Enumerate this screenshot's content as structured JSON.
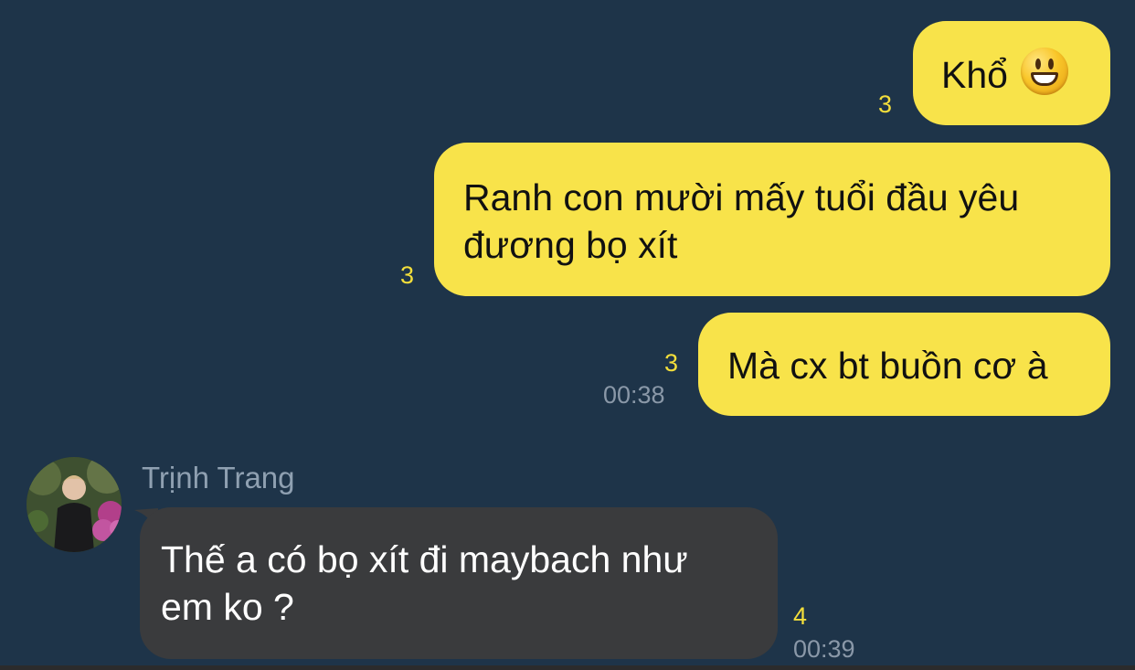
{
  "messages": [
    {
      "text": "Khổ",
      "emoji": "grinning-face-emoji",
      "read_count": "3"
    },
    {
      "line1": "Ranh con mười mấy tuổi đầu yêu",
      "line2": "đương bọ xít",
      "read_count": "3"
    },
    {
      "text": "Mà cx bt buồn cơ à",
      "read_count": "3",
      "time": "00:38"
    },
    {
      "sender": "Trịnh Trang",
      "line1": "Thế a có bọ xít đi maybach như",
      "line2": "em ko ?",
      "read_count": "4",
      "time": "00:39"
    }
  ],
  "colors": {
    "background": "#1e3449",
    "mine_bubble": "#f8e34a",
    "their_bubble": "#3a3b3d",
    "read_count": "#f3de3b",
    "timestamp": "#8a98a8",
    "sender_name": "#8fa0b1"
  }
}
